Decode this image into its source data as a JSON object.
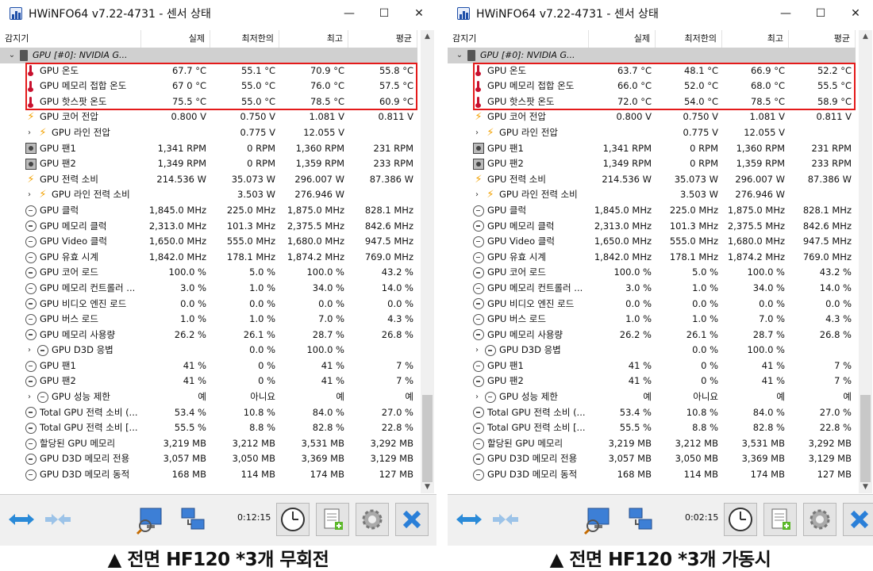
{
  "left": {
    "title": "HWiNFO64 v7.22-4731 - 센서 상태",
    "columns": [
      "감지기",
      "실제",
      "최저한의",
      "최고",
      "평균"
    ],
    "group": "GPU [#0]: NVIDIA G...",
    "timer": "0:12:15",
    "caption": "▲ 전면 HF120 *3개 무회전",
    "rows": [
      {
        "name": "GPU 온도",
        "icon": "therm",
        "v": [
          "67.7 °C",
          "55.1 °C",
          "70.9 °C",
          "55.8 °C"
        ]
      },
      {
        "name": "GPU 메모리 접합 온도",
        "icon": "therm",
        "v": [
          "67 0 °C",
          "55.0 °C",
          "76.0 °C",
          "57.5 °C"
        ]
      },
      {
        "name": "GPU 핫스팟 온도",
        "icon": "therm",
        "v": [
          "75.5 °C",
          "55.0 °C",
          "78.5 °C",
          "60.9 °C"
        ]
      },
      {
        "name": "GPU 코어 전압",
        "icon": "bolt",
        "v": [
          "0.800 V",
          "0.750 V",
          "1.081 V",
          "0.811 V"
        ]
      },
      {
        "name": "GPU 라인 전압",
        "icon": "bolt",
        "sub": true,
        "v": [
          "",
          "0.775 V",
          "12.055 V",
          ""
        ]
      },
      {
        "name": "GPU 팬1",
        "icon": "fan",
        "v": [
          "1,341 RPM",
          "0 RPM",
          "1,360 RPM",
          "231 RPM"
        ]
      },
      {
        "name": "GPU 팬2",
        "icon": "fan",
        "v": [
          "1,349 RPM",
          "0 RPM",
          "1,359 RPM",
          "233 RPM"
        ]
      },
      {
        "name": "GPU 전력 소비",
        "icon": "bolt",
        "v": [
          "214.536 W",
          "35.073 W",
          "296.007 W",
          "87.386 W"
        ]
      },
      {
        "name": "GPU 라인 전력 소비",
        "icon": "bolt",
        "sub": true,
        "v": [
          "",
          "3.503 W",
          "276.946 W",
          ""
        ]
      },
      {
        "name": "GPU 클럭",
        "icon": "clock",
        "v": [
          "1,845.0 MHz",
          "225.0 MHz",
          "1,875.0 MHz",
          "828.1 MHz"
        ]
      },
      {
        "name": "GPU 메모리 클럭",
        "icon": "clock",
        "v": [
          "2,313.0 MHz",
          "101.3 MHz",
          "2,375.5 MHz",
          "842.6 MHz"
        ]
      },
      {
        "name": "GPU Video 클럭",
        "icon": "clock",
        "v": [
          "1,650.0 MHz",
          "555.0 MHz",
          "1,680.0 MHz",
          "947.5 MHz"
        ]
      },
      {
        "name": "GPU 유효 시계",
        "icon": "clock",
        "v": [
          "1,842.0 MHz",
          "178.1 MHz",
          "1,874.2 MHz",
          "769.0 MHz"
        ]
      },
      {
        "name": "GPU 코어 로드",
        "icon": "clock",
        "v": [
          "100.0 %",
          "5.0 %",
          "100.0 %",
          "43.2 %"
        ]
      },
      {
        "name": "GPU 메모리 컨트롤러 ...",
        "icon": "clock",
        "v": [
          "3.0 %",
          "1.0 %",
          "34.0 %",
          "14.0 %"
        ]
      },
      {
        "name": "GPU 비디오 엔진 로드",
        "icon": "clock",
        "v": [
          "0.0 %",
          "0.0 %",
          "0.0 %",
          "0.0 %"
        ]
      },
      {
        "name": "GPU 버스 로드",
        "icon": "clock",
        "v": [
          "1.0 %",
          "1.0 %",
          "7.0 %",
          "4.3 %"
        ]
      },
      {
        "name": "GPU 메모리 사용량",
        "icon": "clock",
        "v": [
          "26.2 %",
          "26.1 %",
          "28.7 %",
          "26.8 %"
        ]
      },
      {
        "name": "GPU D3D 응볍",
        "icon": "clock",
        "sub": true,
        "v": [
          "",
          "0.0 %",
          "100.0 %",
          ""
        ]
      },
      {
        "name": "GPU 팬1",
        "icon": "clock",
        "v": [
          "41 %",
          "0 %",
          "41 %",
          "7 %"
        ]
      },
      {
        "name": "GPU 팬2",
        "icon": "clock",
        "v": [
          "41 %",
          "0 %",
          "41 %",
          "7 %"
        ]
      },
      {
        "name": "GPU 성능 제한",
        "icon": "clock",
        "sub": true,
        "v": [
          "예",
          "아니요",
          "예",
          "예"
        ]
      },
      {
        "name": "Total GPU 전력 소비 (...",
        "icon": "clock",
        "v": [
          "53.4 %",
          "10.8 %",
          "84.0 %",
          "27.0 %"
        ]
      },
      {
        "name": "Total GPU 전력 소비 [...",
        "icon": "clock",
        "v": [
          "55.5 %",
          "8.8 %",
          "82.8 %",
          "22.8 %"
        ]
      },
      {
        "name": "할당된 GPU 메모리",
        "icon": "clock",
        "v": [
          "3,219 MB",
          "3,212 MB",
          "3,531 MB",
          "3,292 MB"
        ]
      },
      {
        "name": "GPU D3D 메모리 전용",
        "icon": "clock",
        "v": [
          "3,057 MB",
          "3,050 MB",
          "3,369 MB",
          "3,129 MB"
        ]
      },
      {
        "name": "GPU D3D 메모리 동적",
        "icon": "clock",
        "v": [
          "168 MB",
          "114 MB",
          "174 MB",
          "127 MB"
        ]
      }
    ]
  },
  "right": {
    "title": "HWiNFO64 v7.22-4731 - 센서 상태",
    "columns": [
      "감지기",
      "실제",
      "최저한의",
      "최고",
      "평균"
    ],
    "group": "GPU [#0]: NVIDIA G...",
    "timer": "0:02:15",
    "caption": "▲ 전면 HF120 *3개 가동시",
    "rows": [
      {
        "name": "GPU 온도",
        "icon": "therm",
        "v": [
          "63.7 °C",
          "48.1 °C",
          "66.9 °C",
          "52.2 °C"
        ]
      },
      {
        "name": "GPU 메모리 접합 온도",
        "icon": "therm",
        "v": [
          "66.0 °C",
          "52.0 °C",
          "68.0 °C",
          "55.5 °C"
        ]
      },
      {
        "name": "GPU 핫스팟 온도",
        "icon": "therm",
        "v": [
          "72.0 °C",
          "54.0 °C",
          "78.5 °C",
          "58.9 °C"
        ]
      },
      {
        "name": "GPU 코어 전압",
        "icon": "bolt",
        "v": [
          "0.800 V",
          "0.750 V",
          "1.081 V",
          "0.811 V"
        ]
      },
      {
        "name": "GPU 라인 전압",
        "icon": "bolt",
        "sub": true,
        "v": [
          "",
          "0.775 V",
          "12.055 V",
          ""
        ]
      },
      {
        "name": "GPU 팬1",
        "icon": "fan",
        "v": [
          "1,341 RPM",
          "0 RPM",
          "1,360 RPM",
          "231 RPM"
        ]
      },
      {
        "name": "GPU 팬2",
        "icon": "fan",
        "v": [
          "1,349 RPM",
          "0 RPM",
          "1,359 RPM",
          "233 RPM"
        ]
      },
      {
        "name": "GPU 전력 소비",
        "icon": "bolt",
        "v": [
          "214.536 W",
          "35.073 W",
          "296.007 W",
          "87.386 W"
        ]
      },
      {
        "name": "GPU 라인 전력 소비",
        "icon": "bolt",
        "sub": true,
        "v": [
          "",
          "3.503 W",
          "276.946 W",
          ""
        ]
      },
      {
        "name": "GPU 클럭",
        "icon": "clock",
        "v": [
          "1,845.0 MHz",
          "225.0 MHz",
          "1,875.0 MHz",
          "828.1 MHz"
        ]
      },
      {
        "name": "GPU 메모리 클럭",
        "icon": "clock",
        "v": [
          "2,313.0 MHz",
          "101.3 MHz",
          "2,375.5 MHz",
          "842.6 MHz"
        ]
      },
      {
        "name": "GPU Video 클럭",
        "icon": "clock",
        "v": [
          "1,650.0 MHz",
          "555.0 MHz",
          "1,680.0 MHz",
          "947.5 MHz"
        ]
      },
      {
        "name": "GPU 유효 시계",
        "icon": "clock",
        "v": [
          "1,842.0 MHz",
          "178.1 MHz",
          "1,874.2 MHz",
          "769.0 MHz"
        ]
      },
      {
        "name": "GPU 코어 로드",
        "icon": "clock",
        "v": [
          "100.0 %",
          "5.0 %",
          "100.0 %",
          "43.2 %"
        ]
      },
      {
        "name": "GPU 메모리 컨트롤러 ...",
        "icon": "clock",
        "v": [
          "3.0 %",
          "1.0 %",
          "34.0 %",
          "14.0 %"
        ]
      },
      {
        "name": "GPU 비디오 엔진 로드",
        "icon": "clock",
        "v": [
          "0.0 %",
          "0.0 %",
          "0.0 %",
          "0.0 %"
        ]
      },
      {
        "name": "GPU 버스 로드",
        "icon": "clock",
        "v": [
          "1.0 %",
          "1.0 %",
          "7.0 %",
          "4.3 %"
        ]
      },
      {
        "name": "GPU 메모리 사용량",
        "icon": "clock",
        "v": [
          "26.2 %",
          "26.1 %",
          "28.7 %",
          "26.8 %"
        ]
      },
      {
        "name": "GPU D3D 응볍",
        "icon": "clock",
        "sub": true,
        "v": [
          "",
          "0.0 %",
          "100.0 %",
          ""
        ]
      },
      {
        "name": "GPU 팬1",
        "icon": "clock",
        "v": [
          "41 %",
          "0 %",
          "41 %",
          "7 %"
        ]
      },
      {
        "name": "GPU 팬2",
        "icon": "clock",
        "v": [
          "41 %",
          "0 %",
          "41 %",
          "7 %"
        ]
      },
      {
        "name": "GPU 성능 제한",
        "icon": "clock",
        "sub": true,
        "v": [
          "예",
          "아니요",
          "예",
          "예"
        ]
      },
      {
        "name": "Total GPU 전력 소비 (...",
        "icon": "clock",
        "v": [
          "53.4 %",
          "10.8 %",
          "84.0 %",
          "27.0 %"
        ]
      },
      {
        "name": "Total GPU 전력 소비 [...",
        "icon": "clock",
        "v": [
          "55.5 %",
          "8.8 %",
          "82.8 %",
          "22.8 %"
        ]
      },
      {
        "name": "할당된 GPU 메모리",
        "icon": "clock",
        "v": [
          "3,219 MB",
          "3,212 MB",
          "3,531 MB",
          "3,292 MB"
        ]
      },
      {
        "name": "GPU D3D 메모리 전용",
        "icon": "clock",
        "v": [
          "3,057 MB",
          "3,050 MB",
          "3,369 MB",
          "3,129 MB"
        ]
      },
      {
        "name": "GPU D3D 메모리 동적",
        "icon": "clock",
        "v": [
          "168 MB",
          "114 MB",
          "174 MB",
          "127 MB"
        ]
      }
    ]
  },
  "colors": {
    "highlight": "#e41a1a",
    "group_bg": "#d0d0d0",
    "toolbar_bg": "#f0f0f0"
  }
}
